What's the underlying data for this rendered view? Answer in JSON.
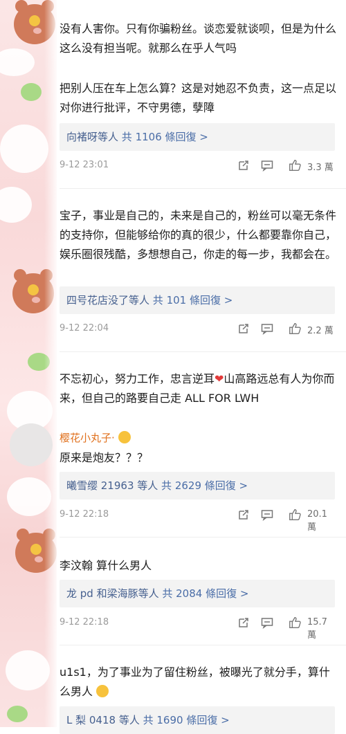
{
  "comments": [
    {
      "text_1": "没有人害你。只有你骗粉丝。谈恋爱就谈呗，但是为什么这么没有担当呢。就那么在乎人气吗",
      "text_2": "把别人压在车上怎么算？这是对她忍不负责，这一点足以对你进行批评，不守男德，孽障",
      "reply_users": "向褚呀等人",
      "reply_count": "共 1106 條回復 >",
      "time": "9-12 23:01",
      "likes": "3.3 萬"
    },
    {
      "text": "宝子，事业是自己的，未来是自己的，粉丝可以毫无条件的支持你，但能够给你的真的很少，什么都要靠你自己，娱乐圈很残酷，多想想自己，你走的每一步，我都会在。",
      "reply_users": "四号花店没了等人",
      "reply_count": "共 101 條回復 >",
      "time": "9-12 22:04",
      "likes": "2.2 萬"
    },
    {
      "text_pre": "不忘初心，努力工作，忠言逆耳",
      "text_post": "山高路远总有人为你而来，但自己的路要自己走  ALL FOR LWH",
      "sub_user": "樱花小丸子·",
      "sub_text": "原来是炮友？？？",
      "reply_users": "曦雪缨 21963 等人",
      "reply_count": "共 2629 條回復 >",
      "time": "9-12 22:18",
      "likes": "20.1 萬"
    },
    {
      "text": "李汶翰  算什么男人",
      "reply_users": "龙 pd 和梁海豚等人",
      "reply_count": "共 2084 條回復 >",
      "time": "9-12 22:18",
      "likes": "15.7 萬"
    },
    {
      "text": "u1s1，为了事业为了留住粉丝，被曝光了就分手，算什么男人",
      "reply_users": "L 梨 0418 等人",
      "reply_count": "共 1690 條回復 >"
    }
  ],
  "icons": {
    "share": "share-icon",
    "comment": "comment-icon",
    "like": "like-icon"
  },
  "colors": {
    "link": "#4a6da7",
    "username": "#e0711e",
    "meta": "#9a9a9a",
    "reply_bg": "#f3f3f3"
  }
}
